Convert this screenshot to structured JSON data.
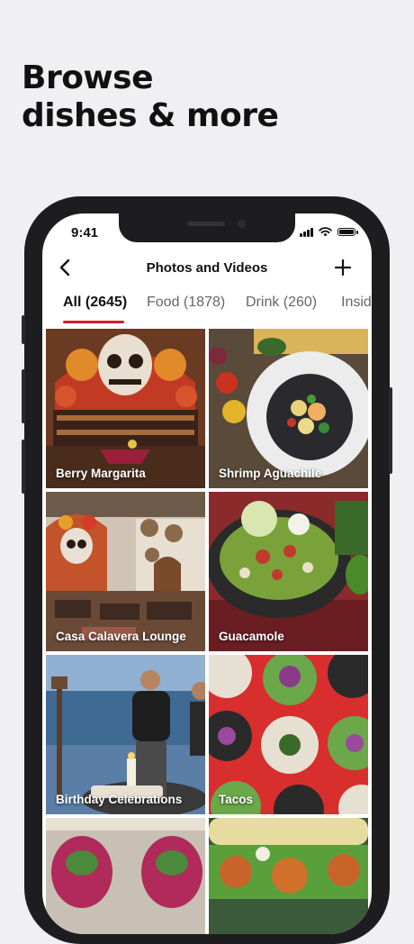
{
  "headline": {
    "line1": "Browse",
    "line2": "dishes & more"
  },
  "status_bar": {
    "time": "9:41"
  },
  "nav": {
    "title": "Photos and Videos"
  },
  "tabs": [
    {
      "label": "All (2645)",
      "active": true
    },
    {
      "label": "Food (1878)",
      "active": false
    },
    {
      "label": "Drink (260)",
      "active": false
    },
    {
      "label": "Insid",
      "active": false
    }
  ],
  "tiles": [
    {
      "caption": "Berry Margarita"
    },
    {
      "caption": "Shrimp Aguachile"
    },
    {
      "caption": "Casa Calavera Lounge"
    },
    {
      "caption": "Guacamole"
    },
    {
      "caption": "Birthday Celebrations"
    },
    {
      "caption": "Tacos"
    },
    {
      "caption": ""
    },
    {
      "caption": ""
    }
  ],
  "colors": {
    "accent": "#d81b2c",
    "background": "#f0f0f2",
    "phone_frame": "#1d1d1f"
  },
  "icons": [
    "back-chevron-icon",
    "plus-icon",
    "signal-icon",
    "wifi-icon",
    "battery-icon"
  ]
}
